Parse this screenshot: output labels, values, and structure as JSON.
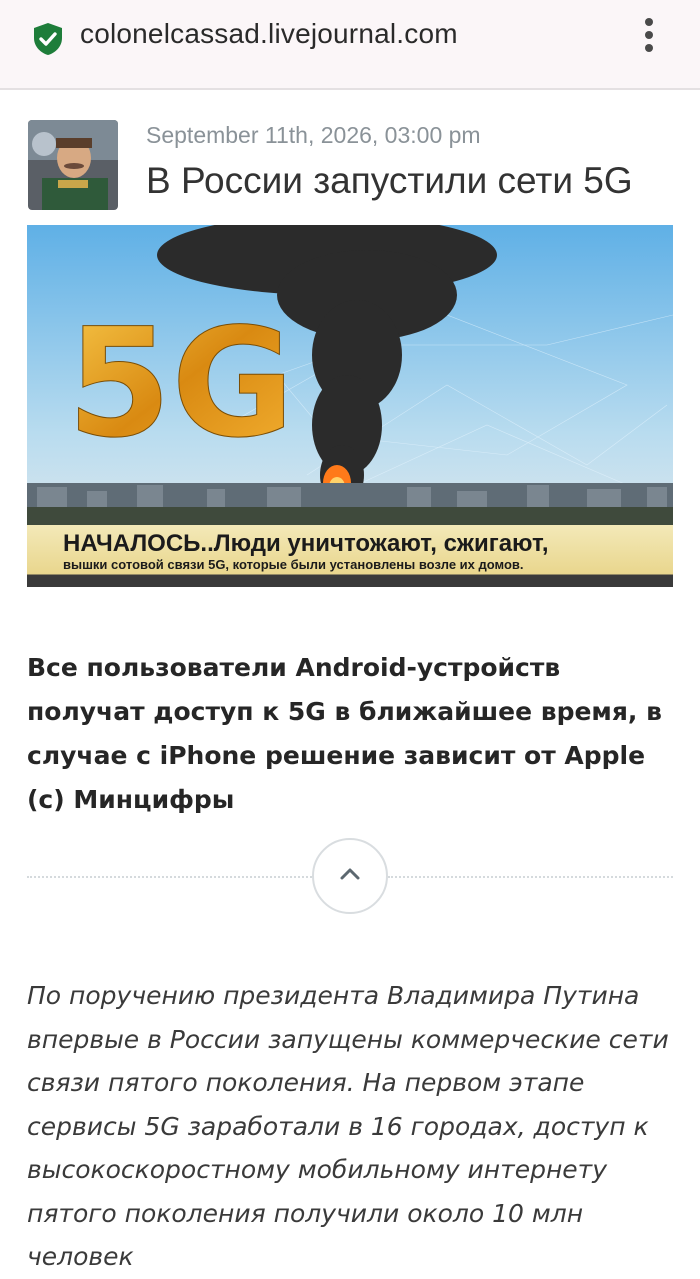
{
  "browser": {
    "url": "colonelcassad.livejournal.com",
    "secure_icon": "shield-check-icon",
    "menu_icon": "more-vert-icon"
  },
  "post": {
    "date": "September 11th, 2026, 03:00 pm",
    "title": "В России запустили сети 5G",
    "image": {
      "logo_text": "5G",
      "caption_line1": "НАЧАЛОСЬ..Люди уничтожают, сжигают,",
      "caption_line2": "вышки сотовой связи 5G, которые были установлены возле их домов."
    },
    "lead": "Все пользователи Android-устройств получат доступ к 5G в ближайшее время, в случае с iPhone решение зависит от Apple (c) Минцифры",
    "collapse_icon": "chevron-up-icon",
    "body": "По поручению президента Владимира Путина впервые в России запущены коммерческие сети связи пятого поколения. На первом этапе сервисы 5G заработали в 16 городах, доступ к высокоскоростному мобильному интернету пятого поколения получили около 10 млн человек"
  },
  "colors": {
    "secure_green": "#1e7d3a",
    "urlbar_bg": "#fbf6f8",
    "date_gray": "#8a9298"
  }
}
